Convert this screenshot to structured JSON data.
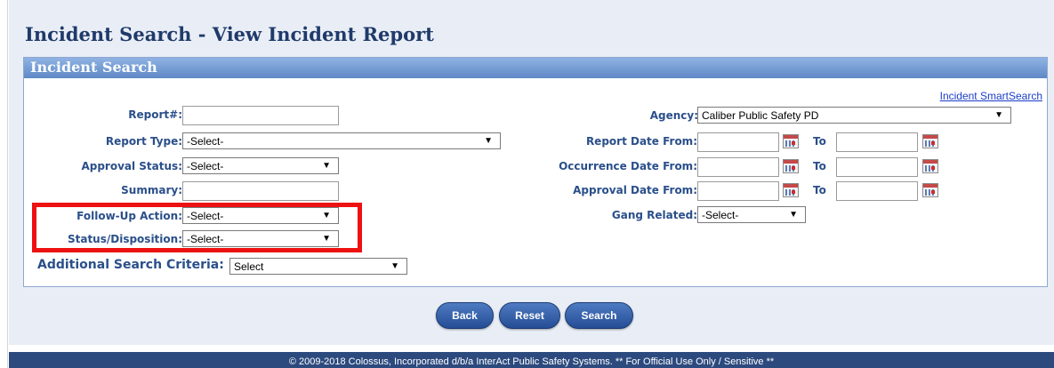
{
  "page": {
    "title": "Incident Search - View Incident Report"
  },
  "panel": {
    "title": "Incident Search",
    "smart_search_link": "Incident SmartSearch"
  },
  "fields": {
    "report_number": {
      "label": "Report#:",
      "value": ""
    },
    "report_type": {
      "label": "Report Type:",
      "selected": "-Select-"
    },
    "approval_status": {
      "label": "Approval Status:",
      "selected": "-Select-"
    },
    "summary": {
      "label": "Summary:",
      "value": ""
    },
    "follow_up_action": {
      "label": "Follow-Up Action:",
      "selected": "-Select-"
    },
    "status_disposition": {
      "label": "Status/Disposition:",
      "selected": "-Select-"
    },
    "agency": {
      "label": "Agency:",
      "selected": "Caliber Public Safety PD"
    },
    "report_date": {
      "label": "Report Date From:",
      "to_label": "To",
      "from": "",
      "to": ""
    },
    "occurrence_date": {
      "label": "Occurrence Date From:",
      "to_label": "To",
      "from": "",
      "to": ""
    },
    "approval_date": {
      "label": "Approval Date From:",
      "to_label": "To",
      "from": "",
      "to": ""
    },
    "gang_related": {
      "label": "Gang Related:",
      "selected": "-Select-"
    },
    "additional_criteria": {
      "label": "Additional Search Criteria:",
      "selected": "Select"
    }
  },
  "dropdown_arrow": "▼",
  "buttons": {
    "back": "Back",
    "reset": "Reset",
    "search": "Search"
  },
  "footer": {
    "text": "© 2009-2018 Colossus, Incorporated d/b/a InterAct Public Safety Systems. ** For Official Use Only / Sensitive **"
  },
  "colors": {
    "title": "#1f3a6a",
    "label": "#2a4f8a",
    "panel_header": "#6f97d1",
    "highlight": "#ee1111",
    "button": "#2f5aa3",
    "footer": "#2c4a7e"
  },
  "icons": {
    "calendar": "calendar-icon",
    "dropdown": "chevron-down-icon"
  }
}
